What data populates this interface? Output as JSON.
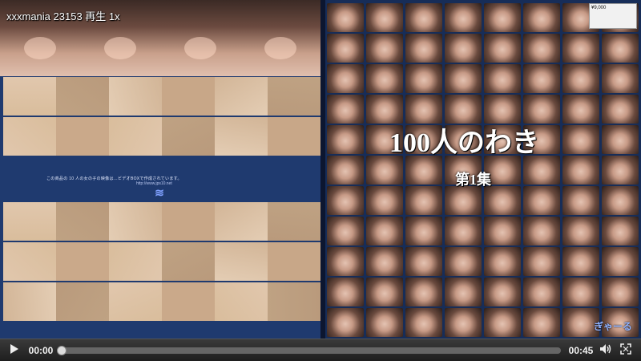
{
  "player": {
    "overlay_title": "xxxmania 23153 再生 1x",
    "time_current": "00:00",
    "time_total": "00:45",
    "progress_fraction": 0.0
  },
  "poster": {
    "title": "100人のわき",
    "subtitle": "第1集",
    "price_badge": "¥9,000",
    "left_band_text": "この商品の 10 人の女の子の映像は…ビデオBOXで作成されています。",
    "left_band_url": "http://www.jps10.net",
    "corner_logo": "ぎゃーる"
  },
  "colors": {
    "accent": "#1f3a6f",
    "control_bar": "#2a2a2a"
  },
  "icons": {
    "play": "play-icon",
    "volume": "volume-icon",
    "fullscreen": "fullscreen-icon"
  }
}
